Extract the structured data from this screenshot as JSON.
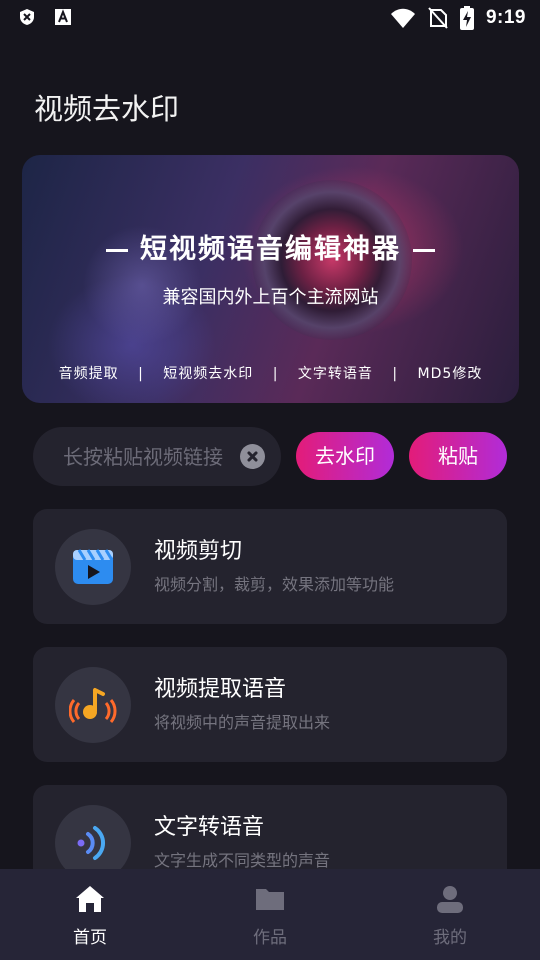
{
  "status_bar": {
    "time": "9:19",
    "left_icons": [
      "shield-x-icon",
      "font-a-icon"
    ],
    "right_icons": [
      "wifi-icon",
      "no-sim-icon",
      "battery-charging-icon"
    ]
  },
  "page": {
    "title": "视频去水印"
  },
  "banner": {
    "title": "短视频语音编辑神器",
    "subtitle": "兼容国内外上百个主流网站",
    "tags": [
      "音频提取",
      "短视频去水印",
      "文字转语音",
      "MD5修改"
    ],
    "separator": "|"
  },
  "search": {
    "placeholder": "长按粘贴视频链接",
    "value": ""
  },
  "actions": {
    "remove_watermark_label": "去水印",
    "paste_label": "粘贴",
    "accent_gradient": [
      "#e31c79",
      "#b12cd8"
    ]
  },
  "features": [
    {
      "title": "视频剪切",
      "desc": "视频分割，裁剪，效果添加等功能",
      "icon": "video-clip-icon"
    },
    {
      "title": "视频提取语音",
      "desc": "将视频中的声音提取出来",
      "icon": "audio-extract-icon"
    },
    {
      "title": "文字转语音",
      "desc": "文字生成不同类型的声音",
      "icon": "text-to-speech-icon"
    }
  ],
  "bottom_nav": {
    "items": [
      {
        "label": "首页",
        "icon": "home-icon",
        "active": true
      },
      {
        "label": "作品",
        "icon": "folder-icon",
        "active": false
      },
      {
        "label": "我的",
        "icon": "profile-icon",
        "active": false
      }
    ]
  },
  "colors": {
    "background": "#16151d",
    "card": "#24232e",
    "nav": "#262537",
    "muted_text": "#75747f"
  }
}
